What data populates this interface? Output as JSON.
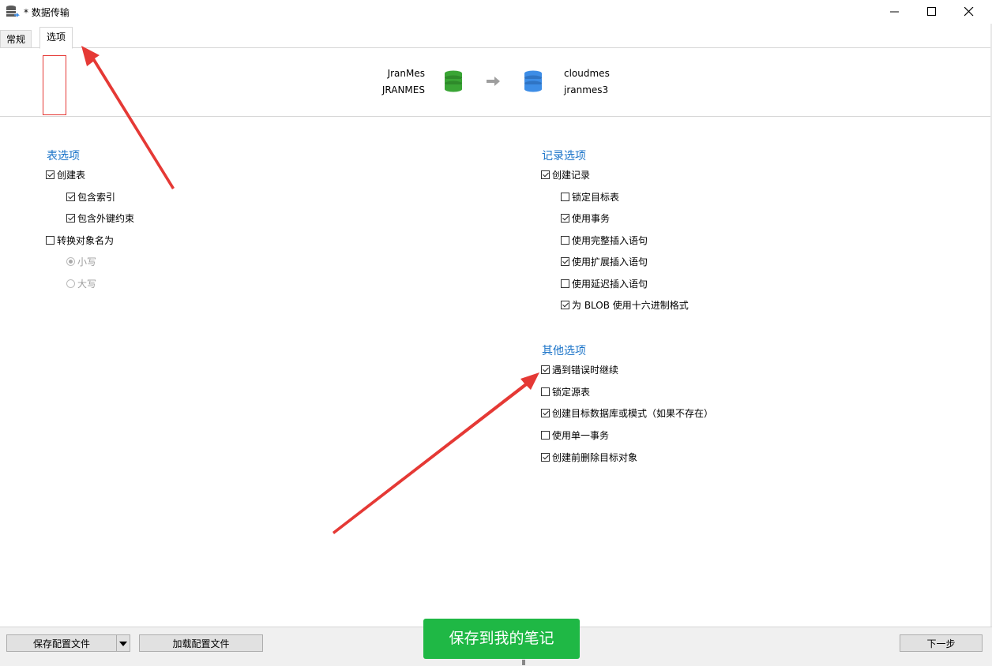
{
  "window": {
    "title": "* 数据传输"
  },
  "tabs": [
    {
      "label": "常规",
      "active": false
    },
    {
      "label": "选项",
      "active": true
    }
  ],
  "connection": {
    "source_name": "JranMes",
    "source_db": "JRANMES",
    "target_name": "cloudmes",
    "target_db": "jranmes3",
    "source_color": "#3aa535",
    "target_color": "#3d8de6"
  },
  "table_options": {
    "title": "表选项",
    "create_table": {
      "label": "创建表",
      "checked": true
    },
    "include_index": {
      "label": "包含索引",
      "checked": true
    },
    "include_fk": {
      "label": "包含外键约束",
      "checked": true
    },
    "convert_name": {
      "label": "转换对象名为",
      "checked": false
    },
    "lowercase": {
      "label": "小写",
      "selected": true
    },
    "uppercase": {
      "label": "大写",
      "selected": false
    }
  },
  "record_options": {
    "title": "记录选项",
    "create_records": {
      "label": "创建记录",
      "checked": true
    },
    "lock_target": {
      "label": "锁定目标表",
      "checked": false
    },
    "use_transaction": {
      "label": "使用事务",
      "checked": true
    },
    "complete_insert": {
      "label": "使用完整插入语句",
      "checked": false
    },
    "extended_insert": {
      "label": "使用扩展插入语句",
      "checked": true
    },
    "delayed_insert": {
      "label": "使用延迟插入语句",
      "checked": false
    },
    "blob_hex": {
      "label": "为 BLOB 使用十六进制格式",
      "checked": true
    }
  },
  "other_options": {
    "title": "其他选项",
    "continue_on_error": {
      "label": "遇到错误时继续",
      "checked": true
    },
    "lock_source": {
      "label": "锁定源表",
      "checked": false
    },
    "create_target_db": {
      "label": "创建目标数据库或模式（如果不存在）",
      "checked": true
    },
    "single_transaction": {
      "label": "使用单一事务",
      "checked": false
    },
    "drop_before_create": {
      "label": "创建前删除目标对象",
      "checked": true
    }
  },
  "bottom": {
    "save_profile": "保存配置文件",
    "load_profile": "加载配置文件",
    "next": "下一步",
    "note_overlay": "保存到我的笔记"
  },
  "annotation_color": "#e53935"
}
